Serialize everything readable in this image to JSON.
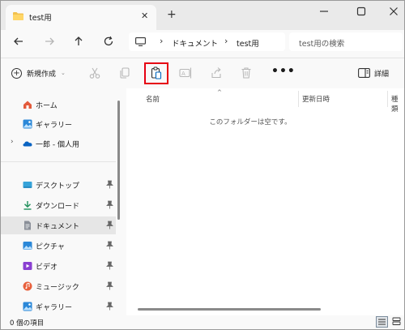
{
  "tab": {
    "title": "test用"
  },
  "address": {
    "crumbs": [
      "ドキュメント",
      "test用"
    ],
    "search_placeholder": "test用の検索"
  },
  "toolbar": {
    "new_label": "新規作成",
    "more_label": "•••",
    "details_label": "詳細"
  },
  "sidebar": {
    "items": [
      {
        "label": "ホーム",
        "icon": "home-icon"
      },
      {
        "label": "ギャラリー",
        "icon": "gallery-icon"
      },
      {
        "label": "一郎 - 個人用",
        "icon": "onedrive-icon"
      },
      {
        "label": "デスクトップ",
        "icon": "desktop-icon",
        "pinned": true
      },
      {
        "label": "ダウンロード",
        "icon": "download-icon",
        "pinned": true
      },
      {
        "label": "ドキュメント",
        "icon": "documents-icon",
        "pinned": true,
        "selected": true
      },
      {
        "label": "ピクチャ",
        "icon": "pictures-icon",
        "pinned": true
      },
      {
        "label": "ビデオ",
        "icon": "videos-icon",
        "pinned": true
      },
      {
        "label": "ミュージック",
        "icon": "music-icon",
        "pinned": true
      },
      {
        "label": "ギャラリー",
        "icon": "gallery-icon",
        "pinned": true
      }
    ]
  },
  "columns": [
    "名前",
    "更新日時",
    "種類"
  ],
  "empty_message": "このフォルダーは空です。",
  "status": {
    "item_count": "0 個の項目"
  },
  "colors": {
    "highlight": "#e60012",
    "folder": "#f2c14e",
    "accent": "#0067c0"
  }
}
